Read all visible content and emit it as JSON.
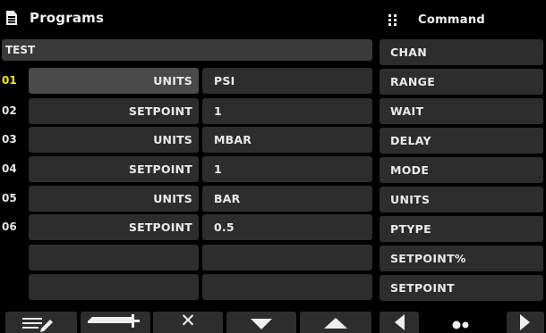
{
  "header": {
    "title": "Programs",
    "icon": "document-icon"
  },
  "command_panel": {
    "title": "Command",
    "icon": "grid-icon",
    "items": [
      "CHAN",
      "RANGE",
      "WAIT",
      "DELAY",
      "MODE",
      "UNITS",
      "PTYPE",
      "SETPOINT%",
      "SETPOINT"
    ]
  },
  "program": {
    "name": "TEST",
    "rows": [
      {
        "num": "01",
        "command": "UNITS",
        "value": "PSI"
      },
      {
        "num": "02",
        "command": "SETPOINT",
        "value": "1"
      },
      {
        "num": "03",
        "command": "UNITS",
        "value": "MBAR"
      },
      {
        "num": "04",
        "command": "SETPOINT",
        "value": "1"
      },
      {
        "num": "05",
        "command": "UNITS",
        "value": "BAR"
      },
      {
        "num": "06",
        "command": "SETPOINT",
        "value": "0.5"
      },
      {
        "num": "",
        "command": "",
        "value": ""
      },
      {
        "num": "",
        "command": "",
        "value": ""
      }
    ],
    "active_row": 0
  },
  "toolbar": {
    "buttons": [
      "edit-icon",
      "insert-icon",
      "delete-icon",
      "move-down-icon",
      "move-up-icon"
    ],
    "delete_glyph": "✕"
  },
  "pager": {
    "buttons": [
      "previous-page-icon",
      "page-indicator-dots",
      "next-page-icon"
    ]
  },
  "colors": {
    "background": "#000000",
    "cell": "#2d2d2d",
    "selected_cell": "#4a4a4a",
    "active_number": "#f2e600",
    "text": "#eaeaea"
  }
}
